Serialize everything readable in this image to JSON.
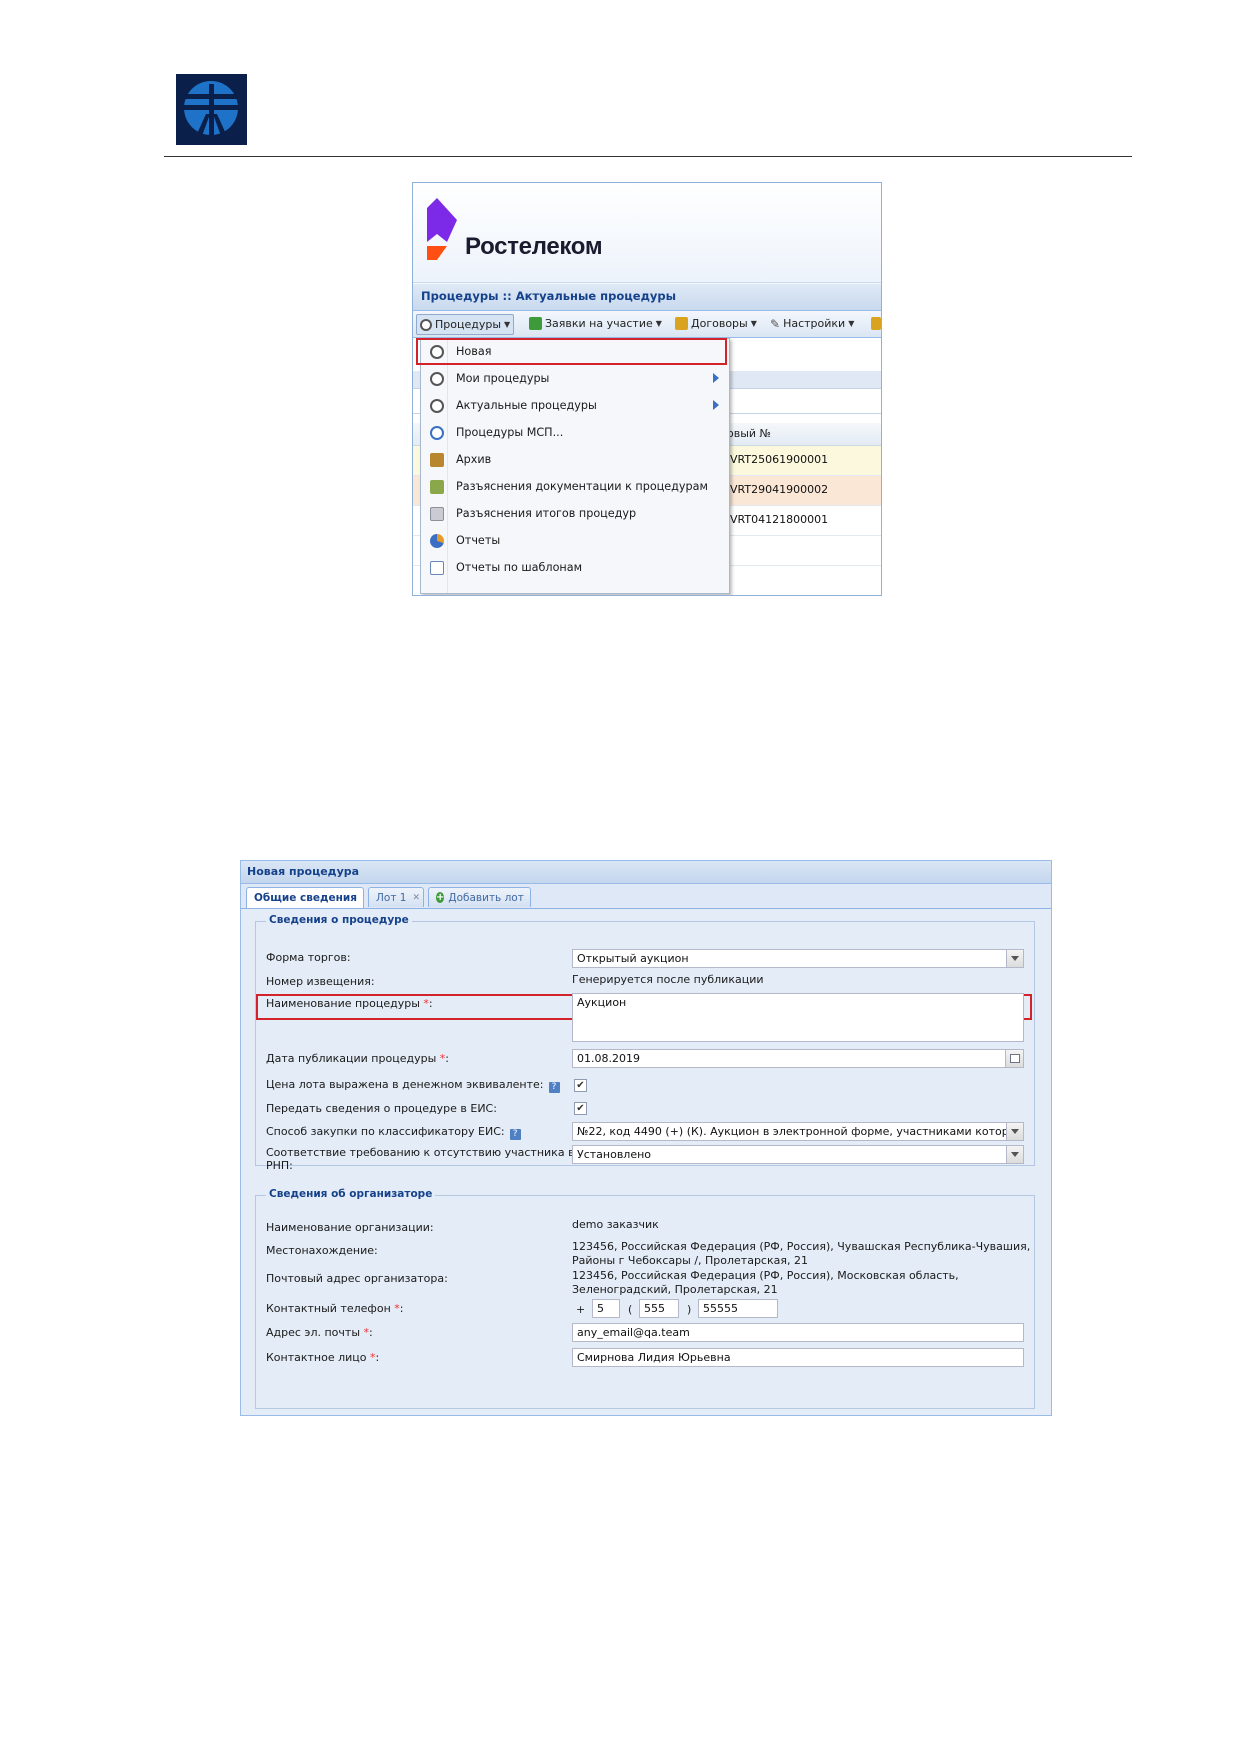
{
  "doc_logo": {
    "icon": "ett-emblem-icon",
    "bg_color": "#0a1f4a",
    "fg_color": "#1e73c8"
  },
  "screenshot1": {
    "brand": {
      "name": "Ростелеком",
      "colors": {
        "purple": "#7d2ae8",
        "orange": "#ff4f12"
      }
    },
    "title": "Процедуры :: Актуальные процедуры",
    "toolbar": [
      {
        "label": "Процедуры",
        "icon": "gear-icon"
      },
      {
        "label": "Заявки на участие",
        "icon": "spreadsheet-icon"
      },
      {
        "label": "Договоры",
        "icon": "contracts-icon"
      },
      {
        "label": "Настройки",
        "icon": "wrench-icon"
      }
    ],
    "grid": {
      "header": "овый №",
      "rows": [
        "VRT25061900001",
        "VRT29041900002",
        "VRT04121800001"
      ]
    },
    "menu": [
      {
        "label": "Новая",
        "icon": "gear-plus-icon",
        "submenu": false
      },
      {
        "label": "Мои процедуры",
        "icon": "gear-user-icon",
        "submenu": true
      },
      {
        "label": "Актуальные процедуры",
        "icon": "gear-icon",
        "submenu": true
      },
      {
        "label": "Процедуры МСП...",
        "icon": "gear-icon",
        "submenu": false
      },
      {
        "label": "Архив",
        "icon": "archive-icon",
        "submenu": false
      },
      {
        "label": "Разъяснения документации к процедурам",
        "icon": "doc-question-icon",
        "submenu": false
      },
      {
        "label": "Разъяснения итогов процедур",
        "icon": "doc-icon",
        "submenu": false
      },
      {
        "label": "Отчеты",
        "icon": "pie-chart-icon",
        "submenu": false
      },
      {
        "label": "Отчеты по шаблонам",
        "icon": "report-template-icon",
        "submenu": false
      }
    ]
  },
  "screenshot2": {
    "title": "Новая процедура",
    "tabs": {
      "general": "Общие сведения",
      "lot": "Лот 1",
      "lot_close": "✕",
      "add_lot": "Добавить лот"
    },
    "procedure": {
      "legend": "Сведения о процедуре",
      "trade_form_label": "Форма торгов:",
      "trade_form_value": "Открытый аукцион",
      "notice_label": "Номер извещения:",
      "notice_value": "Генерируется после публикации",
      "name_label": "Наименование процедуры",
      "name_value": "Аукцион",
      "pubdate_label": "Дата публикации процедуры",
      "pubdate_value": "01.08.2019",
      "money_label": "Цена лота выражена в денежном эквиваленте:",
      "money_checked": true,
      "eis_label": "Передать сведения о процедуре в ЕИС:",
      "eis_checked": true,
      "method_label": "Способ закупки по классификатору ЕИС:",
      "method_value": "№22, код 4490 (+) (К). Аукцион в электронной форме, участниками которо",
      "rnp_label_1": "Соответствие требованию к отсутствию участника в",
      "rnp_label_2": "РНП:",
      "rnp_value": "Установлено"
    },
    "organizer": {
      "legend": "Сведения об организаторе",
      "org_label": "Наименование организации:",
      "org_value": "demo заказчик",
      "location_label": "Местонахождение:",
      "location_line1": "123456, Российская Федерация (РФ, Россия), Чувашская Республика-Чувашия,",
      "location_line2": "Районы г Чебоксары /, Пролетарская, 21",
      "postal_label": "Почтовый адрес организатора:",
      "postal_line1": "123456, Российская Федерация (РФ, Россия), Московская область,",
      "postal_line2": "Зеленоградский, Пролетарская, 21",
      "phone_label": "Контактный телефон",
      "phone_plus": "+",
      "phone_country": "5",
      "phone_open": "(",
      "phone_code": "555",
      "phone_close": ")",
      "phone_number": "55555",
      "email_label": "Адрес эл. почты",
      "email_value": "any_email@qa.team",
      "contact_label": "Контактное лицо",
      "contact_value": "Смирнова Лидия Юрьевна"
    },
    "required_mark": "*",
    "label_colon": ":",
    "checkmark": "✔"
  },
  "highlight_color": "#d3232a"
}
